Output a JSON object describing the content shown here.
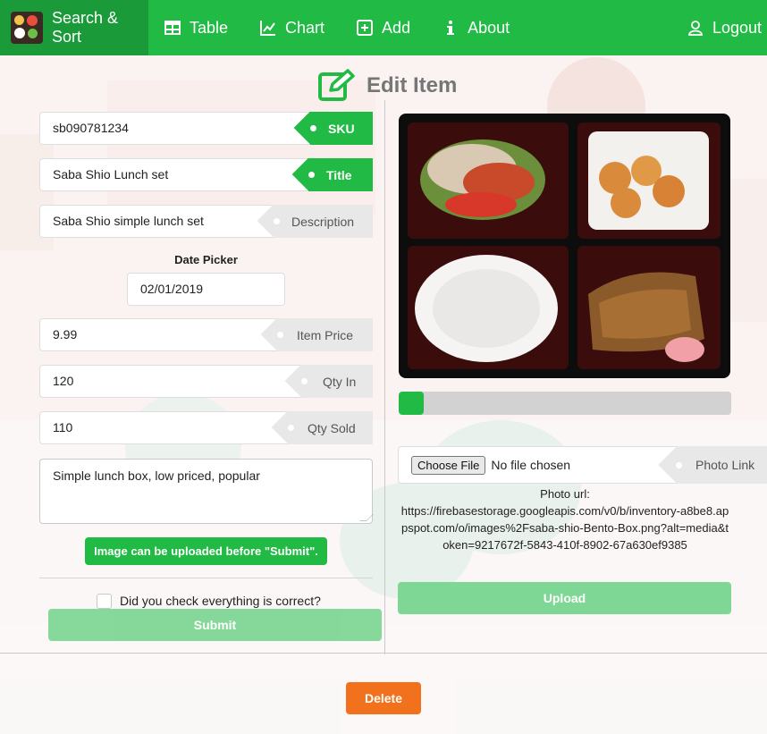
{
  "nav": {
    "brand_label": "Search & Sort",
    "brand_icon": "bento-logo",
    "items": [
      {
        "label": "Table",
        "icon": "table-icon"
      },
      {
        "label": "Chart",
        "icon": "line-chart-icon"
      },
      {
        "label": "Add",
        "icon": "plus-square-icon"
      },
      {
        "label": "About",
        "icon": "info-icon"
      }
    ],
    "logout_label": "Logout",
    "logout_icon": "user-icon"
  },
  "page": {
    "title": "Edit Item",
    "title_icon": "edit-icon"
  },
  "form": {
    "sku": {
      "value": "sb090781234",
      "label": "SKU"
    },
    "title": {
      "value": "Saba Shio Lunch set",
      "label": "Title"
    },
    "description": {
      "value": "Saba Shio simple lunch set",
      "label": "Description"
    },
    "date_picker": {
      "label": "Date Picker",
      "value": "02/01/2019"
    },
    "item_price": {
      "value": "9.99",
      "label": "Item Price"
    },
    "qty_in": {
      "value": "120",
      "label": "Qty In"
    },
    "qty_sold": {
      "value": "110",
      "label": "Qty Sold"
    },
    "notes": "Simple lunch box, low priced, popular",
    "upload_notice": "Image can be uploaded before \"Submit\".",
    "confirm_label": "Did you check everything is correct?",
    "confirm_checked": false,
    "submit_label": "Submit"
  },
  "image_panel": {
    "progress_fraction": 0.075,
    "choose_file_label": "Choose File",
    "file_status": "No file chosen",
    "photo_link_label": "Photo Link",
    "photo_url_label": "Photo url:",
    "photo_url": "https://firebasestorage.googleapis.com/v0/b/inventory-a8be8.appspot.com/o/images%2Fsaba-shio-Bento-Box.png?alt=media&token=9217672f-5843-410f-8902-67a630ef9385",
    "upload_label": "Upload"
  },
  "actions": {
    "delete_label": "Delete"
  },
  "colors": {
    "primary_green": "#21ba45",
    "disabled_green": "#7fd795",
    "delete_orange": "#f2711c",
    "label_gray": "#e8e8e8"
  }
}
